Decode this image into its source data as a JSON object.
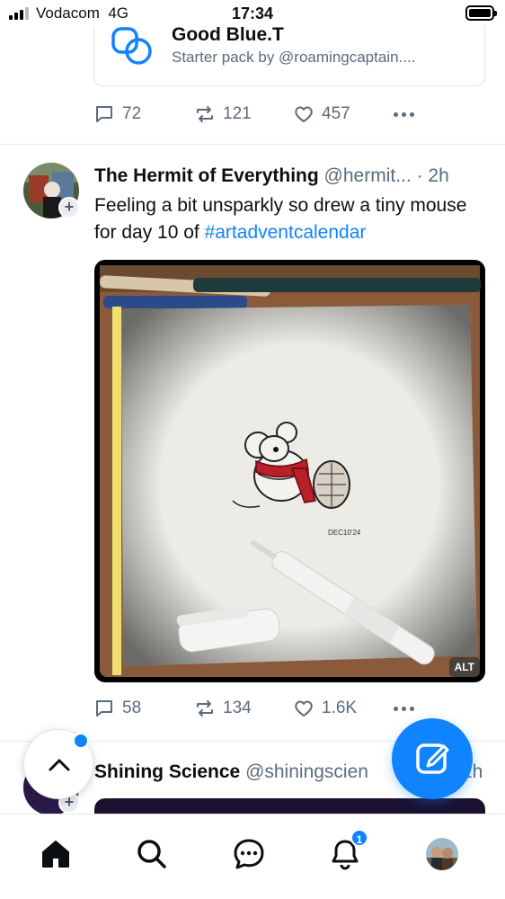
{
  "status_bar": {
    "carrier": "Vodacom",
    "network": "4G",
    "time": "17:34"
  },
  "starter_pack": {
    "title": "Good Blue.T",
    "subtitle": "Starter pack by @roamingcaptain...."
  },
  "post1_actions": {
    "replies": "72",
    "reposts": "121",
    "likes": "457"
  },
  "post2": {
    "author_name": "The Hermit of Everything",
    "handle": "@hermit...",
    "time": "· 2h",
    "text_before": "Feeling a bit unsparkly so drew a tiny mouse for day 10 of ",
    "hashtag": "#artadventcalendar",
    "image_alt_badge": "ALT",
    "replies": "58",
    "reposts": "134",
    "likes": "1.6K"
  },
  "post3": {
    "author_name": "Shining Science",
    "handle": "@shiningscien",
    "time": "2h"
  },
  "bottom_nav": {
    "items": [
      "home",
      "search",
      "chat",
      "notifications",
      "profile"
    ],
    "notification_count": "1"
  },
  "colors": {
    "accent": "#1083fe",
    "muted": "#5b6b7c",
    "text": "#0b0f14"
  }
}
